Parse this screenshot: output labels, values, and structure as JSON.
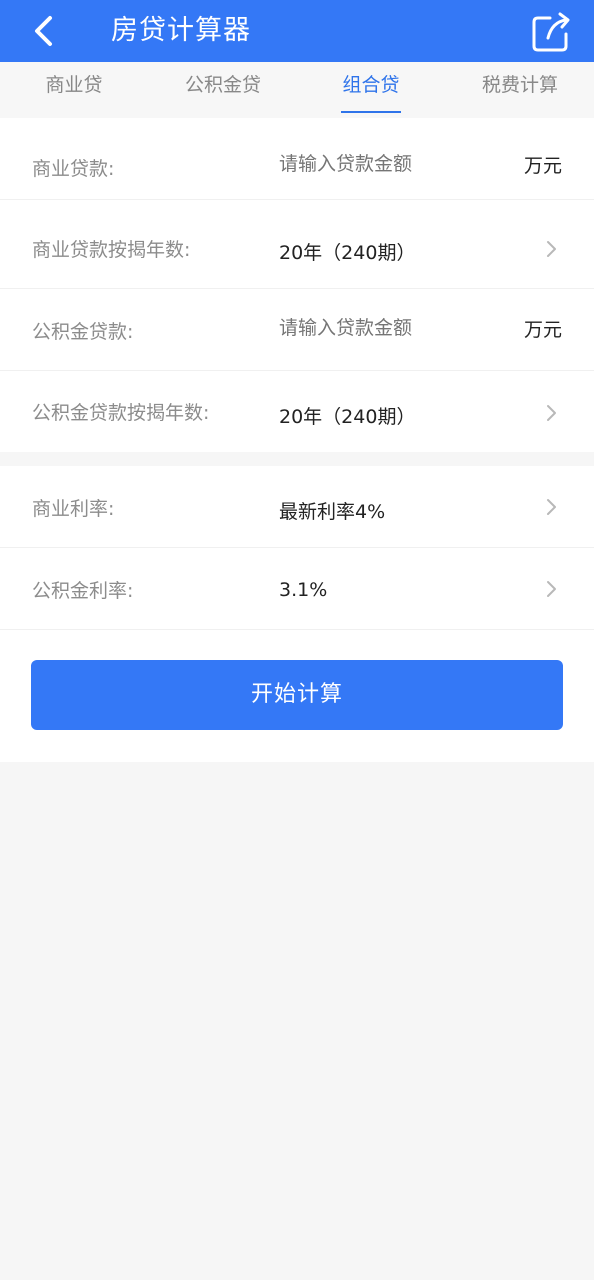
{
  "header": {
    "title": "房贷计算器"
  },
  "tabs": [
    {
      "label": "商业贷"
    },
    {
      "label": "公积金贷"
    },
    {
      "label": "组合贷"
    },
    {
      "label": "税费计算"
    }
  ],
  "form": {
    "commercial_loan": {
      "label": "商业贷款:",
      "placeholder": "请输入贷款金额",
      "unit": "万元"
    },
    "commercial_years": {
      "label": "商业贷款按揭年数:",
      "value": "20年（240期）"
    },
    "fund_loan": {
      "label": "公积金贷款:",
      "placeholder": "请输入贷款金额",
      "unit": "万元"
    },
    "fund_years": {
      "label": "公积金贷款按揭年数:",
      "value": "20年（240期）"
    },
    "commercial_rate": {
      "label": "商业利率:",
      "value": "最新利率4%"
    },
    "fund_rate": {
      "label": "公积金利率:",
      "value": "3.1%"
    }
  },
  "action": {
    "calc_label": "开始计算"
  },
  "colors": {
    "primary": "#3478f6",
    "active_tab": "#2f74ea"
  }
}
